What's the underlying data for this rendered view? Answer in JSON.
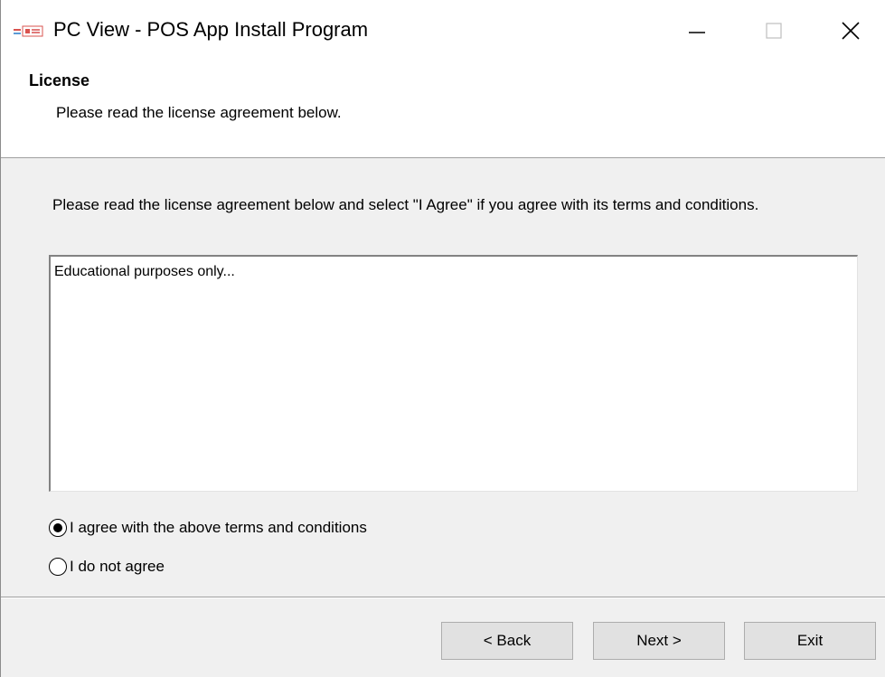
{
  "window": {
    "title": "PC View - POS App Install Program",
    "icon": "pos-app-icon",
    "controls": {
      "minimize_icon": "minimize-icon",
      "maximize_icon": "maximize-icon",
      "close_icon": "close-icon"
    }
  },
  "header": {
    "title": "License",
    "subtitle": "Please read the license agreement below."
  },
  "body": {
    "instructions": "Please read the license agreement below and select \"I Agree\" if you agree with its terms and conditions.",
    "license_text": "Educational purposes only...",
    "options": [
      {
        "label": "I agree with the above terms and conditions",
        "selected": true
      },
      {
        "label": "I do not agree",
        "selected": false
      }
    ]
  },
  "footer": {
    "back_label": "< Back",
    "next_label": "Next >",
    "exit_label": "Exit"
  }
}
